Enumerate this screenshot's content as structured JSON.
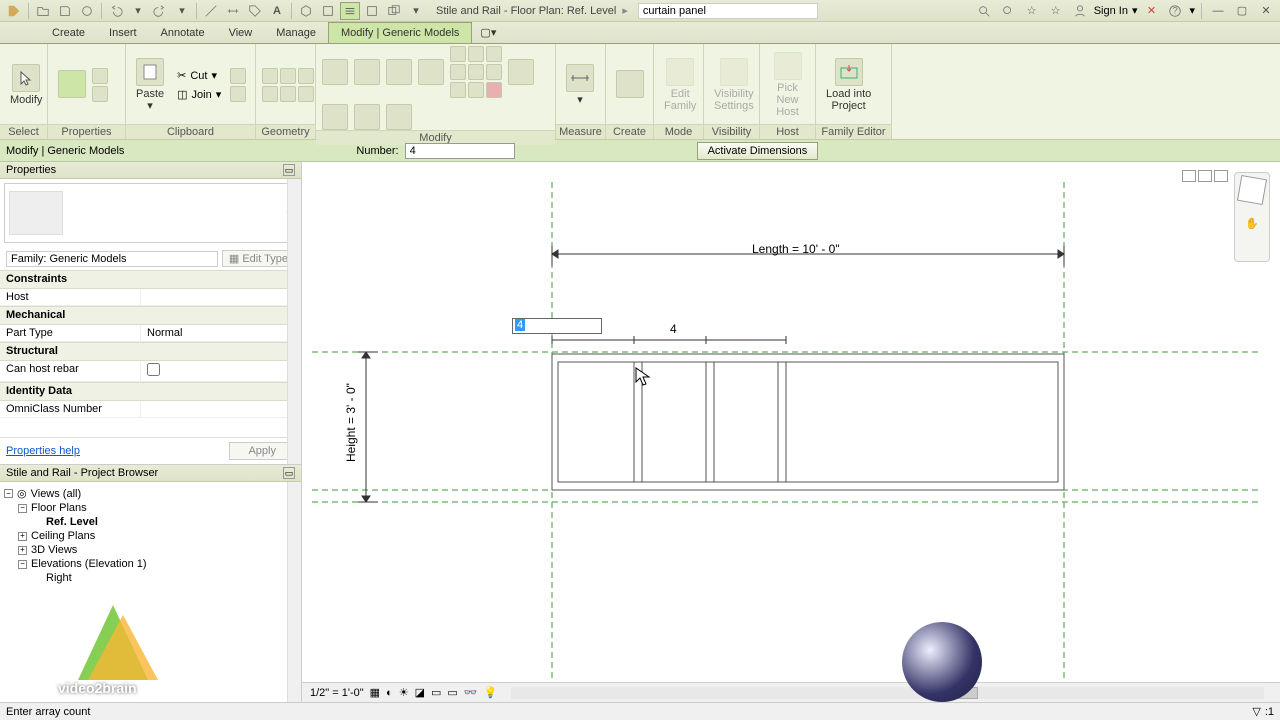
{
  "qat": {
    "title": "Stile and Rail - Floor Plan: Ref. Level",
    "search_placeholder": "curtain panel",
    "signin": "Sign In"
  },
  "menu": {
    "tabs": [
      "Create",
      "Insert",
      "Annotate",
      "View",
      "Manage"
    ],
    "active": "Modify | Generic Models"
  },
  "ribbon": {
    "panels": {
      "select": {
        "title": "Select",
        "modify": "Modify"
      },
      "properties": {
        "title": "Properties"
      },
      "clipboard": {
        "title": "Clipboard",
        "paste": "Paste",
        "cut": "Cut",
        "join": "Join"
      },
      "geometry": {
        "title": "Geometry"
      },
      "modify": {
        "title": "Modify"
      },
      "measure": {
        "title": "Measure"
      },
      "create": {
        "title": "Create"
      },
      "mode": {
        "title": "Mode",
        "edit_family": "Edit\nFamily"
      },
      "visibility": {
        "title": "Visibility",
        "vis_settings": "Visibility\nSettings"
      },
      "host": {
        "title": "Host",
        "pick_host": "Pick\nNew Host"
      },
      "family_editor": {
        "title": "Family Editor",
        "load": "Load into\nProject"
      }
    }
  },
  "options": {
    "context": "Modify | Generic Models",
    "number_label": "Number:",
    "number_value": "4",
    "activate": "Activate Dimensions"
  },
  "properties": {
    "header": "Properties",
    "family_label": "Family: Generic Models",
    "edit_type": "Edit Type",
    "cats": {
      "constraints": "Constraints",
      "mechanical": "Mechanical",
      "structural": "Structural",
      "identity": "Identity Data"
    },
    "rows": {
      "host_k": "Host",
      "host_v": "",
      "parttype_k": "Part Type",
      "parttype_v": "Normal",
      "rebar_k": "Can host rebar",
      "omni_k": "OmniClass Number",
      "omni_v": ""
    },
    "help": "Properties help",
    "apply": "Apply"
  },
  "browser": {
    "header": "Stile and Rail - Project Browser",
    "views": "Views (all)",
    "floor_plans": "Floor Plans",
    "ref_level": "Ref. Level",
    "ceiling": "Ceiling Plans",
    "views3d": "3D Views",
    "elevations": "Elevations (Elevation 1)",
    "right": "Right"
  },
  "canvas": {
    "length_label": "Length = 10' - 0\"",
    "height_label": "Height = 3' - 0\"",
    "array_edit": "4",
    "array_lbl": "4",
    "scale": "1/2\" = 1'-0\""
  },
  "status": {
    "msg": "Enter array count",
    "sel": ":1"
  },
  "watermark": "video2brain"
}
